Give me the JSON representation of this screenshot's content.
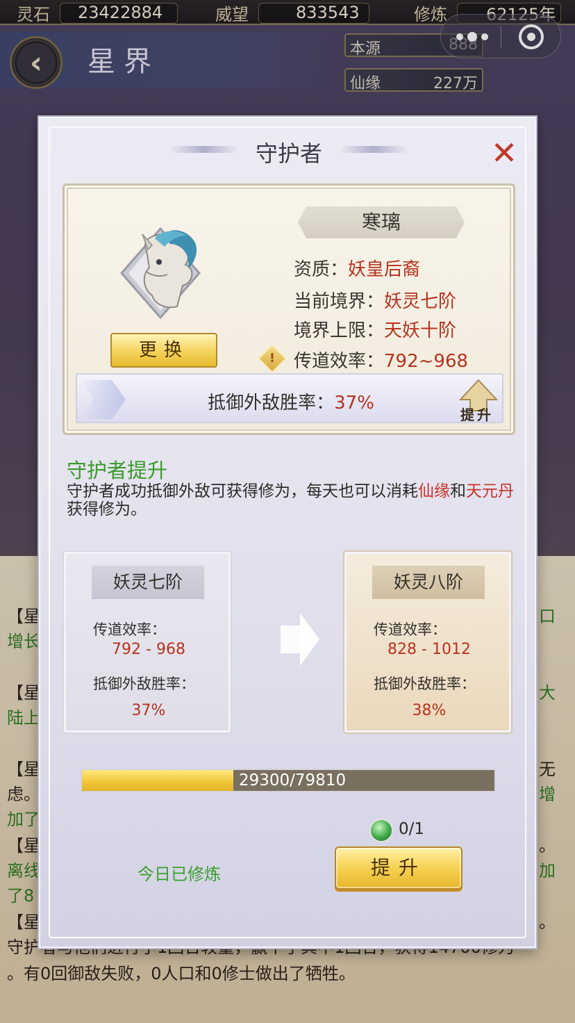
{
  "topbar": {
    "stone_label": "灵石",
    "stone_value": "23422884",
    "prestige_label": "威望",
    "prestige_value": "833543",
    "cultivation_label": "修炼",
    "cultivation_value": "62125年"
  },
  "header": {
    "back": "‹",
    "title": "星界",
    "source_label": "本源",
    "source_value": "888",
    "fate_label": "仙缘",
    "fate_value": "227万"
  },
  "log": {
    "lines": [
      {
        "text": "【星",
        "tail": "口"
      },
      {
        "text": "增长",
        "tail": ""
      },
      {
        "text": "【星",
        "tail": "大"
      },
      {
        "text": "陆上",
        "tail": ""
      },
      {
        "text": "【星",
        "tail": "无"
      },
      {
        "text": "虑。",
        "tail": "增"
      },
      {
        "text": "加了",
        "tail": ""
      },
      {
        "text": "【星",
        "tail": "。"
      },
      {
        "text": "离线",
        "tail": "加"
      },
      {
        "text": "了8",
        "tail": ""
      },
      {
        "text": "【星",
        "tail": "。"
      },
      {
        "text": "守护者与他们进行了1回合较量，赢下了其中1回合，获得14700修为",
        "tail": ""
      },
      {
        "text": "。有0回御敌失败，0人口和0修士做出了牺牲。",
        "tail": ""
      }
    ]
  },
  "dialog": {
    "title": "守护者",
    "close": "✕",
    "guardian": {
      "name": "寒璃",
      "change_label": "更换",
      "aptitude_label": "资质：",
      "aptitude_value": "妖皇后裔",
      "realm_label": "当前境界：",
      "realm_value": "妖灵七阶",
      "limit_label": "境界上限：",
      "limit_value": "天妖十阶",
      "efficiency_label": "传道效率：",
      "efficiency_value": "792~968",
      "defense_label": "抵御外敌胜率：",
      "defense_value": "37%",
      "raise_label": "提升",
      "info_icon": "!"
    },
    "upgrade_section": {
      "title": "守护者提升",
      "desc_1": "守护者成功抵御外敌可获得修为，每天也可以消耗",
      "desc_hl1": "仙缘",
      "desc_2": "和",
      "desc_hl2": "天元丹",
      "desc_3": "获得修为。"
    },
    "current": {
      "stage": "妖灵七阶",
      "efficiency_label": "传道效率：",
      "efficiency_value": "792 - 968",
      "defense_label": "抵御外敌胜率：",
      "defense_value": "37%"
    },
    "next": {
      "stage": "妖灵八阶",
      "efficiency_label": "传道效率：",
      "efficiency_value": "828 - 1012",
      "defense_label": "抵御外敌胜率：",
      "defense_value": "38%"
    },
    "progress": {
      "current": 29300,
      "max": 79810,
      "text": "29300/79810"
    },
    "item_count": "0/1",
    "today_status": "今日已修炼",
    "upgrade_button": "提升"
  },
  "colors": {
    "accent_red": "#b8321e",
    "accent_green": "#3a9a2c",
    "button_gold": "#f4d35a"
  }
}
